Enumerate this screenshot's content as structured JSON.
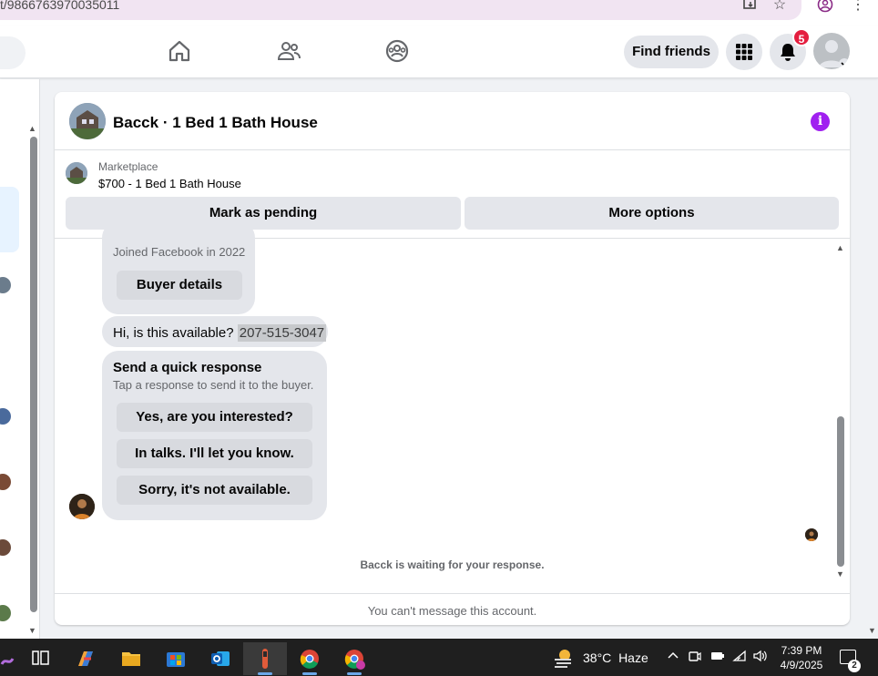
{
  "browser": {
    "url_fragment": "t/9866763970035011"
  },
  "nav": {
    "find_friends": "Find friends",
    "notification_count": "5"
  },
  "conversation": {
    "title": "Bacck · 1 Bed 1 Bath House",
    "listing": {
      "source": "Marketplace",
      "price_title": "$700 - 1 Bed 1 Bath House",
      "mark_pending": "Mark as pending",
      "more_options": "More options"
    },
    "joined": "Joined Facebook in 2022",
    "buyer_details": "Buyer details",
    "message_text": "Hi, is this available?",
    "message_phone": "207-515-3047",
    "quick_response": {
      "title": "Send a quick response",
      "subtitle": "Tap a response to send it to the buyer.",
      "options": [
        "Yes, are you interested?",
        "In talks. I'll let you know.",
        "Sorry, it's not available."
      ]
    },
    "waiting": "Bacck is waiting for your response.",
    "footer": "You can't message this account."
  },
  "taskbar": {
    "weather_temp": "38°C",
    "weather_desc": "Haze",
    "time": "7:39 PM",
    "date": "4/9/2025",
    "notification_count": "2"
  },
  "colors": {
    "accent": "#1877f2",
    "info": "#a020f0",
    "badge": "#e41e3f"
  }
}
